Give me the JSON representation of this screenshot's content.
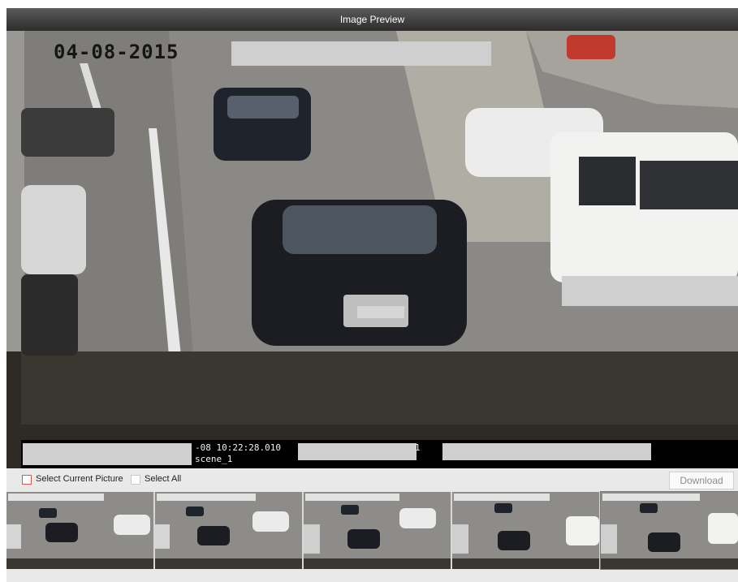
{
  "window": {
    "title": "Image Preview"
  },
  "preview": {
    "camera_date": "04-08-2015",
    "info_line1": "-08 10:22:28.010",
    "info_line1_suffix": "1",
    "info_line2": "scene_1"
  },
  "controls": {
    "select_current": "Select Current Picture",
    "select_all": "Select All",
    "download": "Download"
  },
  "thumbnails": [
    {
      "selected": false
    },
    {
      "selected": false
    },
    {
      "selected": false
    },
    {
      "selected": false
    },
    {
      "selected": true
    }
  ]
}
